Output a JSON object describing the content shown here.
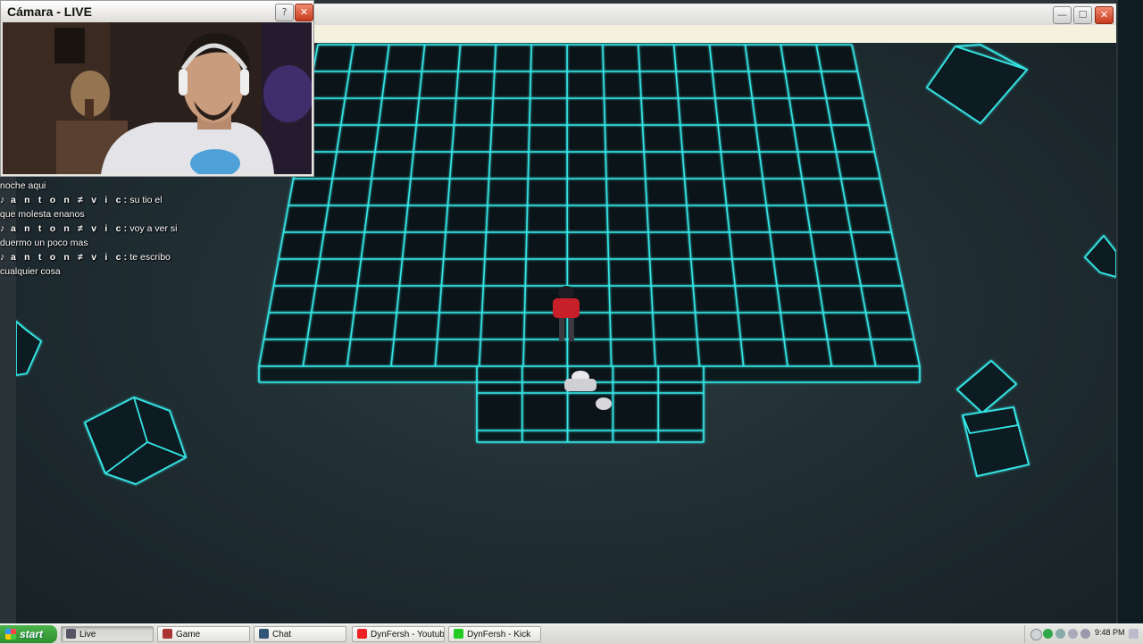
{
  "camera_window": {
    "title": "Cámara - LIVE",
    "help_label": "?",
    "close_label": "✕"
  },
  "game_window": {
    "minimize_label": "—",
    "maximize_label": "☐",
    "close_label": "✕",
    "accent_color": "#35e6e6"
  },
  "chat": {
    "lines": [
      {
        "user": "",
        "text": "noche aqui"
      },
      {
        "user": "a n t o n  ≠  v i c:",
        "text": "su tio el"
      },
      {
        "user": "",
        "text": "que molesta enanos"
      },
      {
        "user": "a n t o n  ≠  v i c:",
        "text": "voy a ver si"
      },
      {
        "user": "",
        "text": "duermo un poco mas"
      },
      {
        "user": "a n t o n  ≠  v i c:",
        "text": "te escribo"
      },
      {
        "user": "",
        "text": "cualquier cosa"
      }
    ],
    "icon": "tiktok-icon"
  },
  "taskbar": {
    "start_label": "start",
    "items": [
      {
        "label": "Live",
        "icon": "window-icon",
        "color": "#556"
      },
      {
        "label": "Game",
        "icon": "game-icon",
        "color": "#a33"
      },
      {
        "label": "Chat",
        "icon": "chat-icon",
        "color": "#357"
      },
      {
        "label": "DynFersh - Youtube",
        "icon": "youtube-icon",
        "color": "#e22"
      },
      {
        "label": "DynFersh - Kick",
        "icon": "kick-icon",
        "color": "#2c2"
      }
    ],
    "clock": "9:48 PM"
  }
}
